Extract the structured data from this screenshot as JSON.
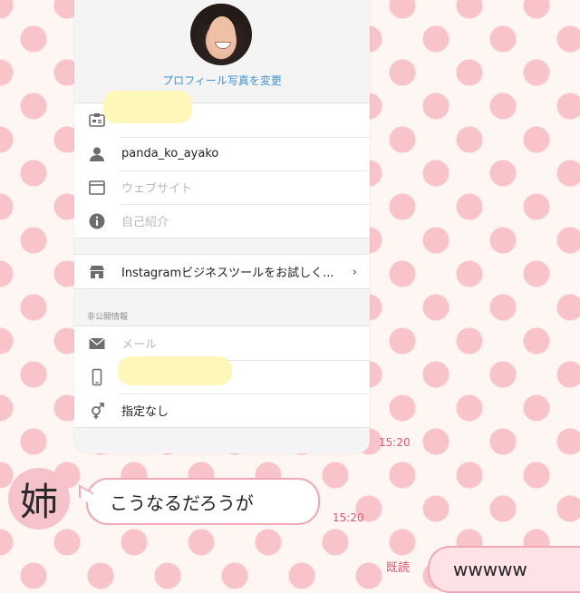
{
  "profile": {
    "change_photo_label": "プロフィール写真を変更"
  },
  "fields_public": [
    {
      "icon": "id-card-icon",
      "value": "",
      "placeholder": false
    },
    {
      "icon": "person-icon",
      "value": "panda_ko_ayako",
      "placeholder": false
    },
    {
      "icon": "website-icon",
      "value": "ウェブサイト",
      "placeholder": true
    },
    {
      "icon": "info-icon",
      "value": "自己紹介",
      "placeholder": true
    }
  ],
  "business": {
    "icon": "store-icon",
    "label": "Instagramビジネスツールをお試しく...",
    "chevron": "›"
  },
  "private_section": {
    "label": "非公開情報",
    "fields": [
      {
        "icon": "mail-icon",
        "value": "メール",
        "placeholder": true
      },
      {
        "icon": "phone-icon",
        "value": "",
        "placeholder": false
      },
      {
        "icon": "gender-icon",
        "value": "指定なし",
        "placeholder": false
      }
    ]
  },
  "chat": {
    "timestamp_image": "15:20",
    "sender_avatar_text": "姉",
    "message_text": "こうなるだろうが",
    "timestamp_message": "15:20",
    "read_label": "既読",
    "reply_text": "wwwww"
  },
  "colors": {
    "link_blue": "#3e92d6",
    "accent_pink": "#e2556f",
    "dot_pink": "#f8c3c9"
  }
}
